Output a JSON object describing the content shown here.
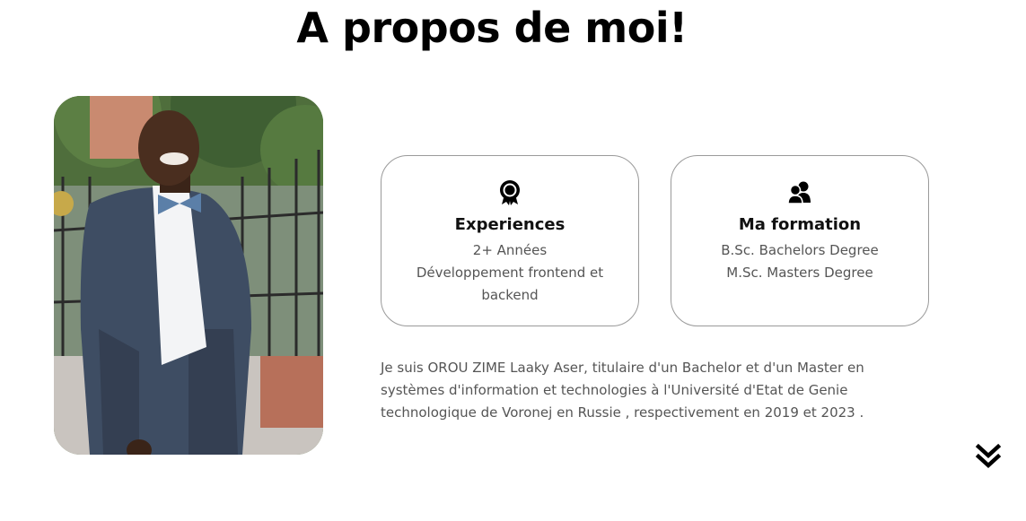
{
  "page": {
    "title": "A propos de moi!"
  },
  "photo": {
    "alt": "Portrait photo"
  },
  "cards": [
    {
      "icon": "award-icon",
      "title": "Experiences",
      "lines": [
        "2+ Années",
        "Développement frontend et backend"
      ]
    },
    {
      "icon": "users-icon",
      "title": "Ma formation",
      "lines": [
        "B.Sc. Bachelors Degree",
        "M.Sc. Masters Degree"
      ]
    }
  ],
  "bio": "Je suis OROU ZIME Laaky Aser, titulaire d'un Bachelor et d'un Master en systèmes d'information et technologies à l'Université d'Etat de Genie technologique de Voronej en Russie , respectivement en 2019 et 2023 .",
  "scroll": {
    "icon": "double-chevron-down-icon"
  },
  "colors": {
    "text": "#000000",
    "muted": "#555555",
    "border": "#9a9a9a"
  }
}
